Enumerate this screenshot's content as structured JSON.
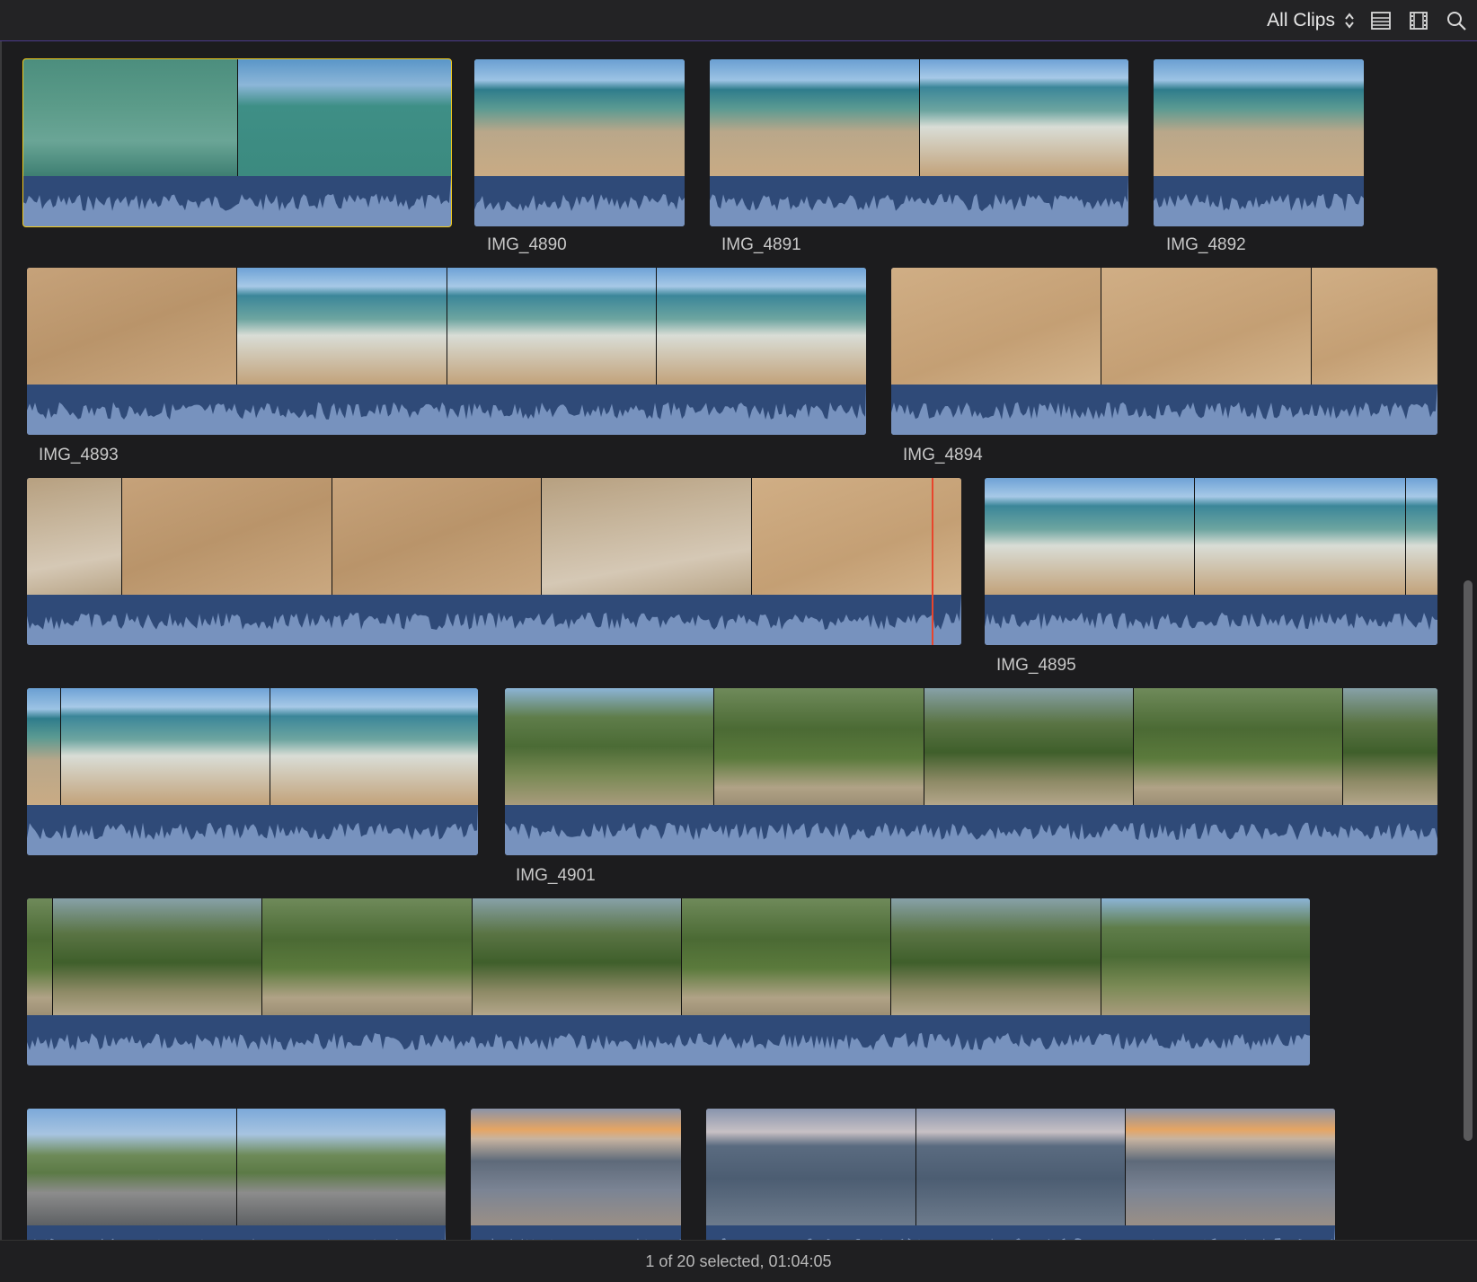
{
  "toolbar": {
    "filter_label": "All Clips",
    "icons": [
      "sort-updown-icon",
      "list-view-icon",
      "filmstrip-icon",
      "search-icon"
    ]
  },
  "clips": [
    {
      "name": ""
    },
    {
      "name": "IMG_4890"
    },
    {
      "name": "IMG_4891"
    },
    {
      "name": "IMG_4892"
    },
    {
      "name": "IMG_4893"
    },
    {
      "name": "IMG_4894"
    },
    {
      "name": ""
    },
    {
      "name": "IMG_4895"
    },
    {
      "name": ""
    },
    {
      "name": "IMG_4901"
    },
    {
      "name": ""
    },
    {
      "name": ""
    },
    {
      "name": ""
    },
    {
      "name": ""
    }
  ],
  "status": {
    "text": "1 of 20 selected, 01:04:05"
  },
  "colors": {
    "selection": "#f5cc1a",
    "playhead": "#e8452c",
    "waveform_bg": "#7792be",
    "waveform_fill": "#2f4a78"
  }
}
